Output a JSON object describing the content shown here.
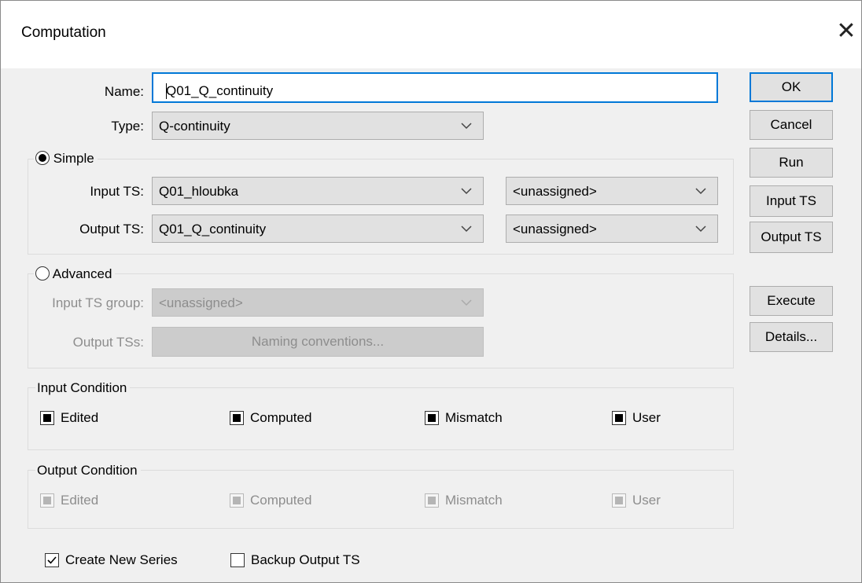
{
  "window": {
    "title": "Computation",
    "close_icon": "close-icon"
  },
  "name": {
    "label": "Name:",
    "value": "Q01_Q_continuity"
  },
  "type": {
    "label": "Type:",
    "value": "Q-continuity"
  },
  "simple": {
    "label": "Simple",
    "selected": true,
    "input_ts": {
      "label": "Input TS:",
      "value": "Q01_hloubka",
      "secondary": "<unassigned>"
    },
    "output_ts": {
      "label": "Output TS:",
      "value": "Q01_Q_continuity",
      "secondary": "<unassigned>"
    }
  },
  "advanced": {
    "label": "Advanced",
    "selected": false,
    "input_group": {
      "label": "Input TS group:",
      "value": "<unassigned>"
    },
    "output_tss": {
      "label": "Output TSs:",
      "button": "Naming conventions..."
    }
  },
  "input_condition": {
    "title": "Input Condition",
    "items": [
      {
        "label": "Edited",
        "state": "indeterminate"
      },
      {
        "label": "Computed",
        "state": "indeterminate"
      },
      {
        "label": "Mismatch",
        "state": "indeterminate"
      },
      {
        "label": "User",
        "state": "indeterminate"
      }
    ]
  },
  "output_condition": {
    "title": "Output Condition",
    "items": [
      {
        "label": "Edited",
        "state": "indeterminate-disabled"
      },
      {
        "label": "Computed",
        "state": "indeterminate-disabled"
      },
      {
        "label": "Mismatch",
        "state": "indeterminate-disabled"
      },
      {
        "label": "User",
        "state": "indeterminate-disabled"
      }
    ]
  },
  "options": {
    "create_new_series": {
      "label": "Create New Series",
      "checked": true
    },
    "backup_output_ts": {
      "label": "Backup Output TS",
      "checked": false
    }
  },
  "buttons": {
    "ok": "OK",
    "cancel": "Cancel",
    "run": "Run",
    "input_ts": "Input TS",
    "output_ts": "Output TS",
    "execute": "Execute",
    "details": "Details..."
  },
  "colors": {
    "accent": "#0078d7",
    "face": "#f0f0f0",
    "button": "#e1e1e1",
    "disabled_text": "#8d8d8d"
  }
}
